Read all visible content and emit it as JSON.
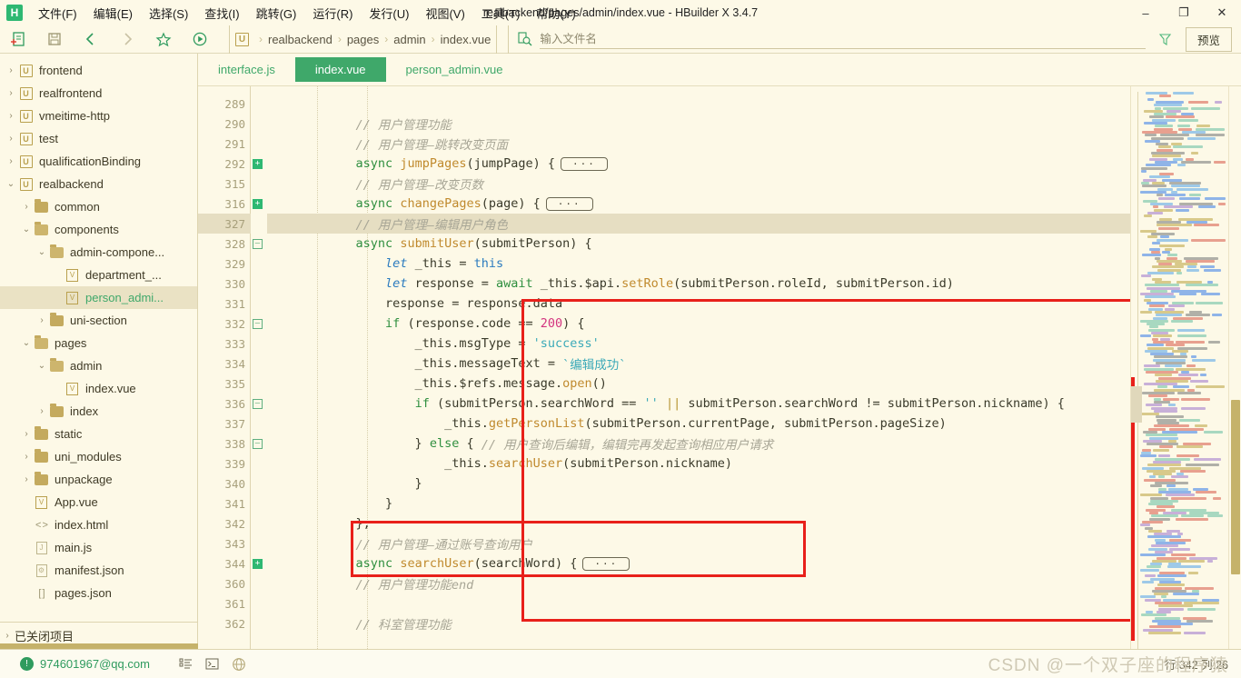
{
  "window": {
    "title": "realbackend/pages/admin/index.vue - HBuilder X 3.4.7",
    "logo": "H",
    "minimize": "–",
    "maximize": "❐",
    "close": "✕"
  },
  "menu": [
    {
      "label": "文件(F)",
      "name": "menu-file"
    },
    {
      "label": "编辑(E)",
      "name": "menu-edit"
    },
    {
      "label": "选择(S)",
      "name": "menu-select"
    },
    {
      "label": "查找(I)",
      "name": "menu-find"
    },
    {
      "label": "跳转(G)",
      "name": "menu-goto"
    },
    {
      "label": "运行(R)",
      "name": "menu-run"
    },
    {
      "label": "发行(U)",
      "name": "menu-publish"
    },
    {
      "label": "视图(V)",
      "name": "menu-view"
    },
    {
      "label": "工具(T)",
      "name": "menu-tools"
    },
    {
      "label": "帮助(Y)",
      "name": "menu-help"
    }
  ],
  "toolbar": {
    "icons": [
      "new-file-icon",
      "save-icon",
      "back-arrow-icon",
      "forward-arrow-icon",
      "star-icon",
      "run-icon"
    ],
    "breadcrumb_badge": "U",
    "breadcrumb": [
      "realbackend",
      "pages",
      "admin",
      "index.vue"
    ],
    "search_placeholder": "输入文件名",
    "search_value": "",
    "filter_icon": "filter-icon",
    "preview_label": "预览"
  },
  "sidebar": {
    "items": [
      {
        "label": "frontend",
        "indent": 0,
        "arrow": "›",
        "icon": "u",
        "selected": false
      },
      {
        "label": "realfrontend",
        "indent": 0,
        "arrow": "›",
        "icon": "u",
        "selected": false
      },
      {
        "label": "vmeitime-http",
        "indent": 0,
        "arrow": "›",
        "icon": "u",
        "selected": false
      },
      {
        "label": "test",
        "indent": 0,
        "arrow": "›",
        "icon": "u",
        "selected": false
      },
      {
        "label": "qualificationBinding",
        "indent": 0,
        "arrow": "›",
        "icon": "u",
        "selected": false
      },
      {
        "label": "realbackend",
        "indent": 0,
        "arrow": "⌄",
        "icon": "u",
        "selected": false
      },
      {
        "label": "common",
        "indent": 1,
        "arrow": "›",
        "icon": "folder",
        "selected": false
      },
      {
        "label": "components",
        "indent": 1,
        "arrow": "⌄",
        "icon": "folder-open",
        "selected": false
      },
      {
        "label": "admin-compone...",
        "indent": 2,
        "arrow": "⌄",
        "icon": "folder-open",
        "selected": false
      },
      {
        "label": "department_...",
        "indent": 3,
        "arrow": "",
        "icon": "vue",
        "selected": false
      },
      {
        "label": "person_admi...",
        "indent": 3,
        "arrow": "",
        "icon": "vue",
        "selected": true
      },
      {
        "label": "uni-section",
        "indent": 2,
        "arrow": "›",
        "icon": "folder",
        "selected": false
      },
      {
        "label": "pages",
        "indent": 1,
        "arrow": "⌄",
        "icon": "folder-open",
        "selected": false
      },
      {
        "label": "admin",
        "indent": 2,
        "arrow": "⌄",
        "icon": "folder-open",
        "selected": false
      },
      {
        "label": "index.vue",
        "indent": 3,
        "arrow": "",
        "icon": "vue",
        "selected": false
      },
      {
        "label": "index",
        "indent": 2,
        "arrow": "›",
        "icon": "folder",
        "selected": false
      },
      {
        "label": "static",
        "indent": 1,
        "arrow": "›",
        "icon": "folder",
        "selected": false
      },
      {
        "label": "uni_modules",
        "indent": 1,
        "arrow": "›",
        "icon": "folder",
        "selected": false
      },
      {
        "label": "unpackage",
        "indent": 1,
        "arrow": "›",
        "icon": "folder",
        "selected": false
      },
      {
        "label": "App.vue",
        "indent": 1,
        "arrow": "",
        "icon": "vue",
        "selected": false
      },
      {
        "label": "index.html",
        "indent": 1,
        "arrow": "",
        "icon": "code",
        "selected": false
      },
      {
        "label": "main.js",
        "indent": 1,
        "arrow": "",
        "icon": "js",
        "selected": false
      },
      {
        "label": "manifest.json",
        "indent": 1,
        "arrow": "",
        "icon": "cfg",
        "selected": false
      },
      {
        "label": "pages.json",
        "indent": 1,
        "arrow": "",
        "icon": "arr",
        "selected": false
      }
    ],
    "closed_projects": "已关闭项目",
    "closed_projects_arrow": "›"
  },
  "tabs": [
    {
      "label": "interface.js",
      "active": false
    },
    {
      "label": "index.vue",
      "active": true
    },
    {
      "label": "person_admin.vue",
      "active": false
    }
  ],
  "code": {
    "lines": [
      {
        "num": "289",
        "fold": "",
        "hl": false,
        "tokens": []
      },
      {
        "num": "290",
        "fold": "",
        "hl": false,
        "tokens": [
          {
            "t": "cm",
            "v": "            // 用户管理功能"
          }
        ]
      },
      {
        "num": "291",
        "fold": "",
        "hl": false,
        "tokens": [
          {
            "t": "cm",
            "v": "            // 用户管理—跳转改变页面"
          }
        ]
      },
      {
        "num": "292",
        "fold": "plus",
        "hl": false,
        "tokens": [
          {
            "t": "pl",
            "v": "            "
          },
          {
            "t": "kw",
            "v": "async"
          },
          {
            "t": "pl",
            "v": " "
          },
          {
            "t": "fn",
            "v": "jumpPages"
          },
          {
            "t": "pl",
            "v": "(jumpPage) {"
          },
          {
            "t": "pill",
            "v": "···"
          }
        ]
      },
      {
        "num": "315",
        "fold": "",
        "hl": false,
        "tokens": [
          {
            "t": "cm",
            "v": "            // 用户管理—改变页数"
          }
        ]
      },
      {
        "num": "316",
        "fold": "plus",
        "hl": false,
        "tokens": [
          {
            "t": "pl",
            "v": "            "
          },
          {
            "t": "kw",
            "v": "async"
          },
          {
            "t": "pl",
            "v": " "
          },
          {
            "t": "fn",
            "v": "changePages"
          },
          {
            "t": "pl",
            "v": "(page) {"
          },
          {
            "t": "pill",
            "v": "···"
          }
        ]
      },
      {
        "num": "327",
        "fold": "",
        "hl": true,
        "tokens": [
          {
            "t": "cm",
            "v": "            // 用户管理—编辑用户角色"
          }
        ]
      },
      {
        "num": "328",
        "fold": "minus",
        "hl": false,
        "tokens": [
          {
            "t": "pl",
            "v": "            "
          },
          {
            "t": "kw",
            "v": "async"
          },
          {
            "t": "pl",
            "v": " "
          },
          {
            "t": "fn",
            "v": "submitUser"
          },
          {
            "t": "pl",
            "v": "(submitPerson) {"
          }
        ]
      },
      {
        "num": "329",
        "fold": "",
        "hl": false,
        "tokens": [
          {
            "t": "pl",
            "v": "                "
          },
          {
            "t": "kw2",
            "v": "let"
          },
          {
            "t": "pl",
            "v": " _this = "
          },
          {
            "t": "kw3",
            "v": "this"
          }
        ]
      },
      {
        "num": "330",
        "fold": "",
        "hl": false,
        "tokens": [
          {
            "t": "pl",
            "v": "                "
          },
          {
            "t": "kw2",
            "v": "let"
          },
          {
            "t": "pl",
            "v": " response = "
          },
          {
            "t": "kw",
            "v": "await"
          },
          {
            "t": "pl",
            "v": " _this.$api."
          },
          {
            "t": "fn",
            "v": "setRole"
          },
          {
            "t": "pl",
            "v": "(submitPerson.roleId, submitPerson.id)"
          }
        ]
      },
      {
        "num": "331",
        "fold": "",
        "hl": false,
        "tokens": [
          {
            "t": "pl",
            "v": "                response = response.data"
          }
        ]
      },
      {
        "num": "332",
        "fold": "minus",
        "hl": false,
        "tokens": [
          {
            "t": "pl",
            "v": "                "
          },
          {
            "t": "kw",
            "v": "if"
          },
          {
            "t": "pl",
            "v": " (response.code == "
          },
          {
            "t": "num",
            "v": "200"
          },
          {
            "t": "pl",
            "v": ") {"
          }
        ]
      },
      {
        "num": "333",
        "fold": "",
        "hl": false,
        "tokens": [
          {
            "t": "pl",
            "v": "                    _this.msgType = "
          },
          {
            "t": "st",
            "v": "'success'"
          }
        ]
      },
      {
        "num": "334",
        "fold": "",
        "hl": false,
        "tokens": [
          {
            "t": "pl",
            "v": "                    _this.messageText = "
          },
          {
            "t": "st",
            "v": "`编辑成功`"
          }
        ]
      },
      {
        "num": "335",
        "fold": "",
        "hl": false,
        "tokens": [
          {
            "t": "pl",
            "v": "                    _this.$refs.message."
          },
          {
            "t": "fn",
            "v": "open"
          },
          {
            "t": "pl",
            "v": "()"
          }
        ]
      },
      {
        "num": "336",
        "fold": "minus",
        "hl": false,
        "tokens": [
          {
            "t": "pl",
            "v": "                    "
          },
          {
            "t": "kw",
            "v": "if"
          },
          {
            "t": "pl",
            "v": " (submitPerson.searchWord == "
          },
          {
            "t": "st",
            "v": "''"
          },
          {
            "t": "pl",
            "v": " "
          },
          {
            "t": "op",
            "v": "||"
          },
          {
            "t": "pl",
            "v": " submitPerson.searchWord != submitPerson.nickname) {"
          }
        ]
      },
      {
        "num": "337",
        "fold": "",
        "hl": false,
        "tokens": [
          {
            "t": "pl",
            "v": "                        _this."
          },
          {
            "t": "fn",
            "v": "getPersonList"
          },
          {
            "t": "pl",
            "v": "(submitPerson.currentPage, submitPerson.pageSize)"
          }
        ]
      },
      {
        "num": "338",
        "fold": "minus",
        "hl": false,
        "tokens": [
          {
            "t": "pl",
            "v": "                    } "
          },
          {
            "t": "kw",
            "v": "else"
          },
          {
            "t": "pl",
            "v": " { "
          },
          {
            "t": "cm",
            "v": "// 用户查询后编辑，编辑完再发起查询相应用户请求"
          }
        ]
      },
      {
        "num": "339",
        "fold": "",
        "hl": false,
        "tokens": [
          {
            "t": "pl",
            "v": "                        _this."
          },
          {
            "t": "fn",
            "v": "searchUser"
          },
          {
            "t": "pl",
            "v": "(submitPerson.nickname)"
          }
        ]
      },
      {
        "num": "340",
        "fold": "",
        "hl": false,
        "tokens": [
          {
            "t": "pl",
            "v": "                    }"
          }
        ]
      },
      {
        "num": "341",
        "fold": "",
        "hl": false,
        "tokens": [
          {
            "t": "pl",
            "v": "                }"
          }
        ]
      },
      {
        "num": "342",
        "fold": "",
        "hl": false,
        "tokens": [
          {
            "t": "pl",
            "v": "            },"
          }
        ]
      },
      {
        "num": "343",
        "fold": "",
        "hl": false,
        "tokens": [
          {
            "t": "cm",
            "v": "            // 用户管理—通过账号查询用户"
          }
        ]
      },
      {
        "num": "344",
        "fold": "plus",
        "hl": false,
        "tokens": [
          {
            "t": "pl",
            "v": "            "
          },
          {
            "t": "kw",
            "v": "async"
          },
          {
            "t": "pl",
            "v": " "
          },
          {
            "t": "fn",
            "v": "searchUser"
          },
          {
            "t": "pl",
            "v": "(searchWord) {"
          },
          {
            "t": "pill",
            "v": "···"
          }
        ]
      },
      {
        "num": "360",
        "fold": "",
        "hl": false,
        "tokens": [
          {
            "t": "cm",
            "v": "            // 用户管理功能end"
          }
        ]
      },
      {
        "num": "361",
        "fold": "",
        "hl": false,
        "tokens": []
      },
      {
        "num": "362",
        "fold": "",
        "hl": false,
        "tokens": [
          {
            "t": "cm",
            "v": "            // 科室管理功能"
          }
        ]
      }
    ]
  },
  "statusbar": {
    "account": "974601967@qq.com",
    "account_icon": "user-circle-icon",
    "icons": [
      "outline-icon",
      "terminal-icon",
      "globe-icon"
    ],
    "cursor_position": "行:342  列:26",
    "watermark": "CSDN @一个双子座的程序猿"
  },
  "colors": {
    "accent_green": "#3fa86a",
    "bg": "#fdf9e7",
    "gold": "#c5b26a",
    "annotation_red": "#e8201a"
  }
}
